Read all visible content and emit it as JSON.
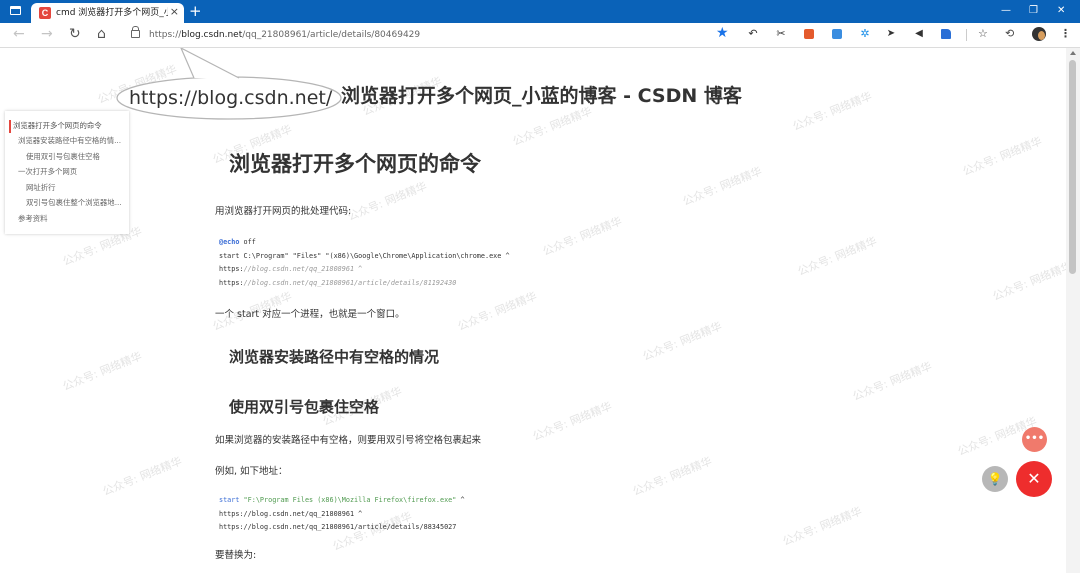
{
  "browser": {
    "tab": {
      "title": "cmd 浏览器打开多个网页_小蓝的",
      "close": "×",
      "favicon": "C"
    },
    "new_tab": "+",
    "window_controls": {
      "minimize": "—",
      "restore": "❐",
      "close": "✕"
    },
    "nav": {
      "back": "←",
      "forward": "→",
      "reload": "↻",
      "home": "⌂"
    },
    "address": {
      "prefix": "https://",
      "host": "blog.csdn.net",
      "path": "/qq_21808961/article/details/80469429"
    },
    "favorite": "★",
    "extension_icons": [
      "translate-extension-icon",
      "tools-extension-icon",
      "note-extension-icon",
      "square-extension-icon",
      "grid-extension-icon",
      "send-extension-icon",
      "audio-extension-icon",
      "tag-extension-icon"
    ],
    "icons": {
      "favorites": "☆",
      "history": "⟲"
    }
  },
  "callout": {
    "text": "https://blog.csdn.net/"
  },
  "page_heading": "浏览器打开多个网页_小蓝的博客 - CSDN 博客",
  "toc": [
    {
      "label": "浏览器打开多个网页的命令"
    },
    {
      "label": "浏览器安装路径中有空格的情..."
    },
    {
      "label": "使用双引号包裹住空格"
    },
    {
      "label": "一次打开多个网页"
    },
    {
      "label": "网址折行"
    },
    {
      "label": "双引号包裹住整个浏览器地..."
    },
    {
      "label": "参考资料"
    }
  ],
  "article": {
    "h1": "浏览器打开多个网页的命令",
    "p1": "用浏览器打开网页的批处理代码:",
    "code1": {
      "line1_kw": "@echo",
      "line1_rest": " off",
      "line2": "start C:\\Program\" \"Files\" \"(x86)\\Google\\Chrome\\Application\\chrome.exe ^",
      "line3_a": "https:",
      "line3_b": "//blog.csdn.net/qq_21808961 ^",
      "line4_a": "https:",
      "line4_b": "//blog.csdn.net/qq_21808961/article/details/81192430"
    },
    "p2": "一个 start 对应一个进程，也就是一个窗口。",
    "h2a": "浏览器安装路径中有空格的情况",
    "h2b": "使用双引号包裹住空格",
    "p3": "如果浏览器的安装路径中有空格，则要用双引号将空格包裹起来",
    "p4": "例如, 如下地址：",
    "code2": {
      "line1_kw": "start",
      "line1_str": " \"F:\\Program Files (x86)\\Mozilla Firefox\\firefox.exe\"",
      "line1_end": " ^",
      "line2": "https://blog.csdn.net/qq_21808961 ^",
      "line3": "https://blog.csdn.net/qq_21808961/article/details/88345027"
    },
    "p5": "要替换为:"
  },
  "fab": {
    "more": "•••",
    "light": "💡",
    "close": "✕"
  },
  "watermark": "公众号: 网络精华"
}
